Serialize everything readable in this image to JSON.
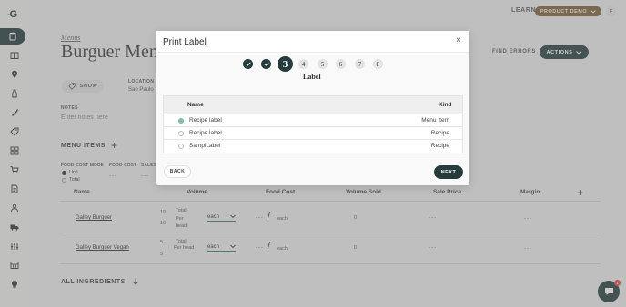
{
  "sidebar": {
    "logo": "-G",
    "items": [
      {
        "icon": "clipboard-icon",
        "active": true
      },
      {
        "icon": "book-icon"
      },
      {
        "icon": "location-pin-icon"
      },
      {
        "icon": "bottle-icon"
      },
      {
        "icon": "carrot-icon"
      },
      {
        "icon": "tag-icon"
      },
      {
        "icon": "grid-icon"
      },
      {
        "icon": "cart-icon"
      },
      {
        "icon": "document-icon"
      },
      {
        "icon": "people-icon"
      },
      {
        "icon": "truck-icon"
      },
      {
        "icon": "sliders-icon"
      },
      {
        "icon": "calendar-grid-icon"
      },
      {
        "icon": "bulb-icon"
      }
    ]
  },
  "topbar": {
    "learn": "LEARN",
    "product_demo": "PRODUCT DEMO",
    "avatar": "F"
  },
  "header": {
    "breadcrumb": "Menus",
    "title": "Burguer Menu",
    "find_errors": "FIND ERRORS",
    "actions": "ACTIONS"
  },
  "filters": {
    "show": "SHOW",
    "location_label": "LOCATION",
    "location_value": "Sao Paulo",
    "notes_label": "NOTES",
    "notes_placeholder": "Enter notes here"
  },
  "menu_items": {
    "label": "MENU ITEMS",
    "food_cost_mode_label": "FOOD COST MODE",
    "food_cost_label": "FOOD COST",
    "sales_label": "SALES",
    "mode_unit": "Unit",
    "mode_total": "Total",
    "food_cost_value": "---",
    "sales_value": "---"
  },
  "table": {
    "columns": [
      "Name",
      "Volume",
      "Food Cost",
      "Volume Sold",
      "Sale Price",
      "Margin"
    ],
    "rows": [
      {
        "name": "Galley Burguer",
        "vol_a": "10",
        "vol_b": "10",
        "total_label": "Total",
        "per_label": "Per head",
        "unit": "each",
        "food_cost": "---",
        "food_unit": "each",
        "volume_sold": "0",
        "sale_price": "---",
        "margin": "---"
      },
      {
        "name": "Galley Burguer Vegan",
        "vol_a": "5",
        "vol_b": "5",
        "total_label": "Total",
        "per_label": "Per head",
        "unit": "each",
        "food_cost": "---",
        "food_unit": "each",
        "volume_sold": "0",
        "sale_price": "---",
        "margin": "---"
      }
    ]
  },
  "all_ingredients": "ALL INGREDIENTS",
  "chat": {
    "badge": "1"
  },
  "modal": {
    "title": "Print Label",
    "close": "×",
    "steps": [
      {
        "label": "✓",
        "state": "done"
      },
      {
        "label": "✓",
        "state": "done"
      },
      {
        "label": "3",
        "state": "current"
      },
      {
        "label": "4",
        "state": "pending"
      },
      {
        "label": "5",
        "state": "pending"
      },
      {
        "label": "6",
        "state": "pending"
      },
      {
        "label": "7",
        "state": "pending"
      },
      {
        "label": "8",
        "state": "pending"
      }
    ],
    "current_step_label": "Label",
    "columns": {
      "name": "Name",
      "kind": "Kind"
    },
    "rows": [
      {
        "name": "Recipe label",
        "kind": "Menu Item",
        "selected": true
      },
      {
        "name": "Recipe label",
        "kind": "Recipe",
        "selected": false
      },
      {
        "name": "SampiLabel",
        "kind": "Recipe",
        "selected": false
      }
    ],
    "back": "BACK",
    "next": "NEXT"
  },
  "colors": {
    "primary_dark": "#263b3c",
    "demo_brown": "#7b5f39",
    "selected_green": "#7fbf9e"
  }
}
